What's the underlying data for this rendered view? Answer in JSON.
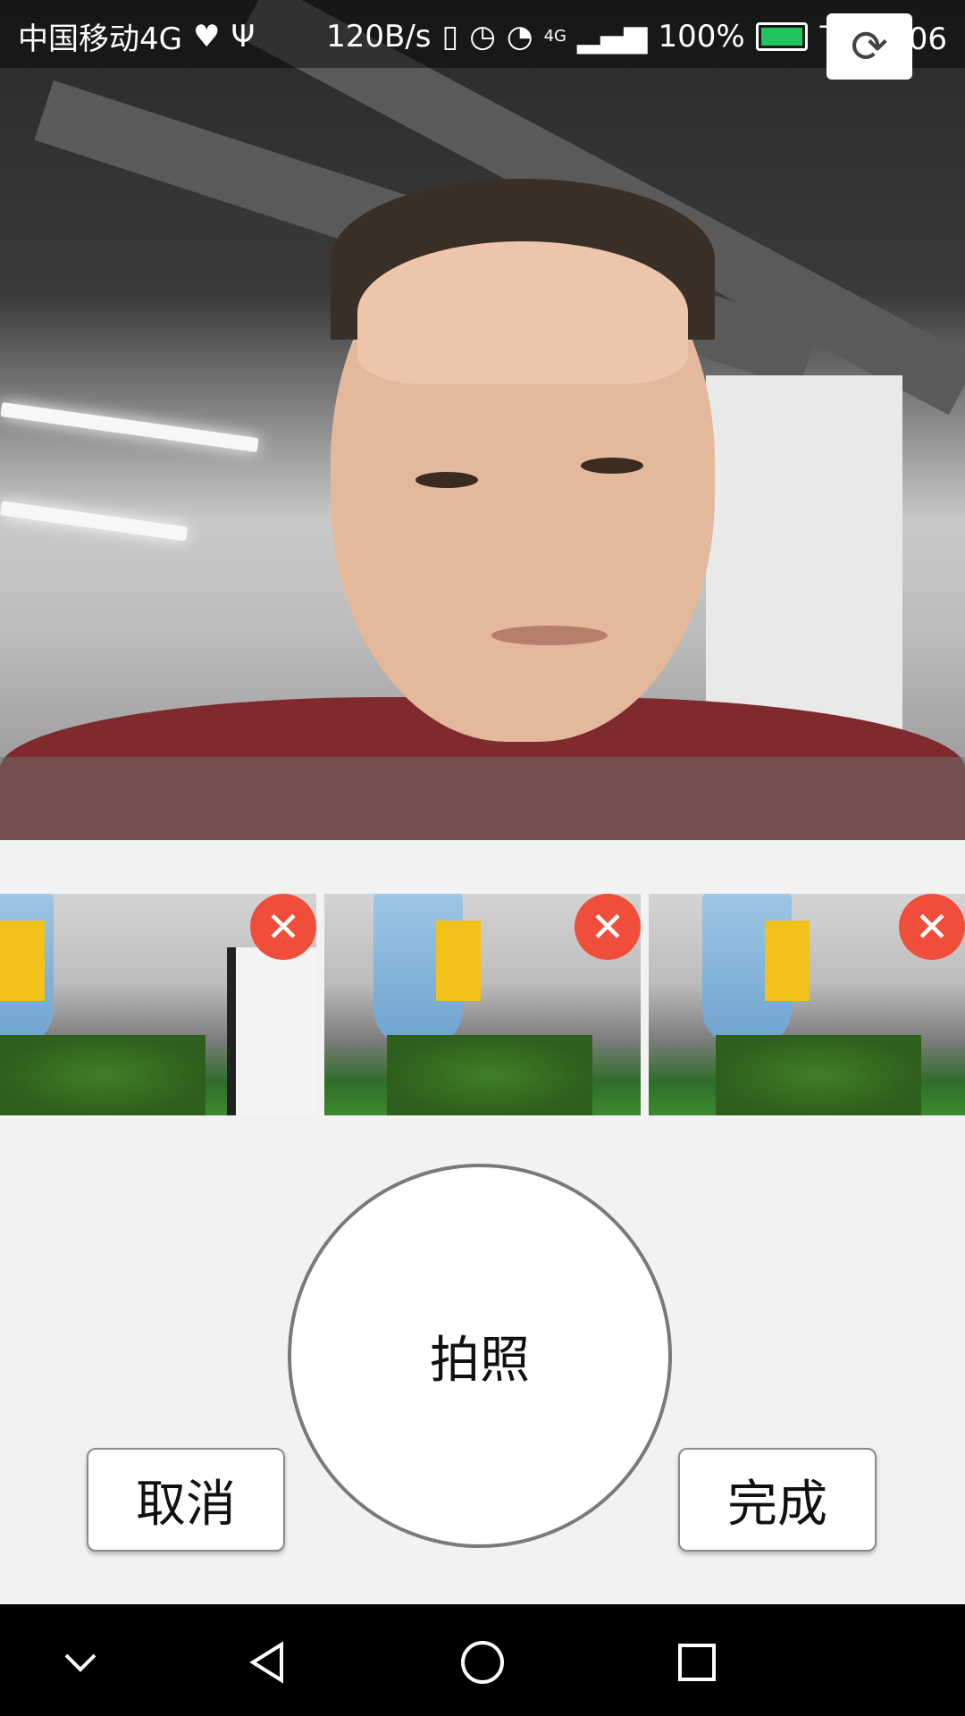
{
  "status_bar": {
    "carrier": "中国移动4G",
    "speed": "120B/s",
    "network": "4G",
    "battery": "100%",
    "time": "下午2:06",
    "icons": [
      "heart-icon",
      "usb-icon",
      "vibrate-icon",
      "alarm-icon",
      "wifi-icon",
      "signal-icon",
      "battery-icon"
    ]
  },
  "camera": {
    "switch_icon": "switch-camera-icon"
  },
  "thumbnails": [
    {
      "name": "captured-photo-1",
      "delete_icon": "close-icon"
    },
    {
      "name": "captured-photo-2",
      "delete_icon": "close-icon"
    },
    {
      "name": "captured-photo-3",
      "delete_icon": "close-icon"
    }
  ],
  "actions": {
    "shutter_label": "拍照",
    "cancel_label": "取消",
    "done_label": "完成"
  },
  "nav_bar": {
    "keys": [
      "chevron-down-icon",
      "back-icon",
      "home-icon",
      "recents-icon"
    ]
  },
  "colors": {
    "delete_badge": "#ef4e3a",
    "battery_fill": "#22c35e",
    "background": "#f2f2f2"
  }
}
